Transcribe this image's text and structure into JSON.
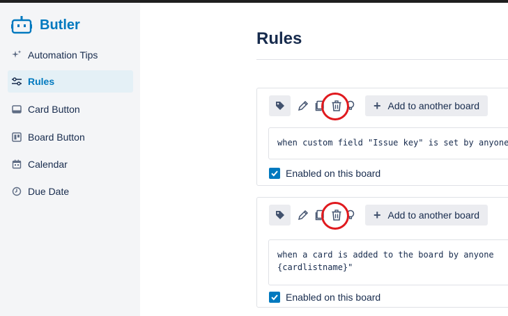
{
  "sidebar": {
    "brand": "Butler",
    "items": [
      {
        "label": "Automation Tips",
        "icon": "sparkle-icon"
      },
      {
        "label": "Rules",
        "icon": "sliders-icon",
        "active": true
      },
      {
        "label": "Card Button",
        "icon": "card-button-icon"
      },
      {
        "label": "Board Button",
        "icon": "board-icon"
      },
      {
        "label": "Calendar",
        "icon": "calendar-icon"
      },
      {
        "label": "Due Date",
        "icon": "clock-icon"
      }
    ]
  },
  "main": {
    "title": "Rules",
    "rules": [
      {
        "add_label": "Add to another board",
        "text": "when custom field \"Issue key\" is set by anyone",
        "enabled_label": "Enabled on this board",
        "enabled": true
      },
      {
        "add_label": "Add to another board",
        "text": "when a card is added to the board by anyone\n{cardlistname}\"",
        "enabled_label": "Enabled on this board",
        "enabled": true
      }
    ]
  },
  "colors": {
    "accent": "#0079bf",
    "highlight": "#e0191e",
    "sidebar_bg": "#f4f5f7"
  }
}
